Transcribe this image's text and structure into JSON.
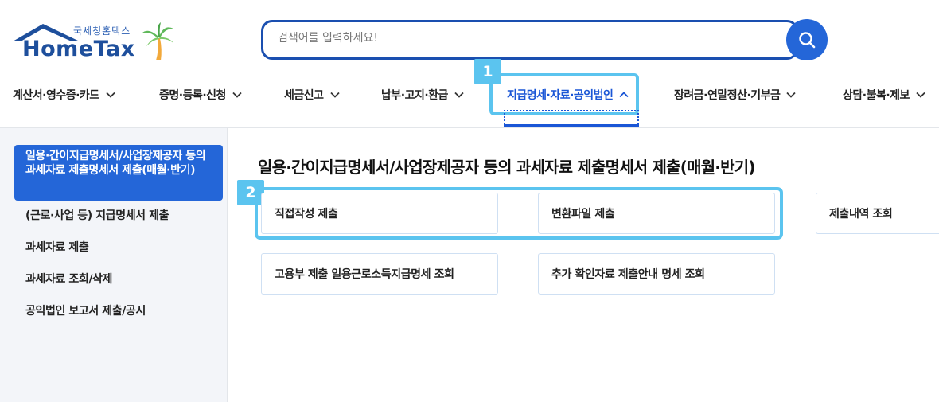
{
  "logo": {
    "sub": "국세청홈택스",
    "main": "HomeTax"
  },
  "search": {
    "placeholder": "검색어를 입력하세요!"
  },
  "nav": {
    "items": [
      {
        "label": "계산서·영수증·카드"
      },
      {
        "label": "증명·등록·신청"
      },
      {
        "label": "세금신고"
      },
      {
        "label": "납부·고지·환급"
      },
      {
        "label": "지급명세·자료·공익법인"
      },
      {
        "label": "장려금·연말정산·기부금"
      },
      {
        "label": "상담·불복·제보"
      }
    ]
  },
  "badges": {
    "one": "1",
    "two": "2"
  },
  "sidebar": {
    "items": [
      {
        "label": "일용·간이지급명세서/사업장제공자 등의 과세자료 제출명세서 제출(매월·반기)"
      },
      {
        "label": "(근로·사업 등) 지급명세서 제출"
      },
      {
        "label": "과세자료 제출"
      },
      {
        "label": "과세자료 조회/삭제"
      },
      {
        "label": "공익법인 보고서 제출/공시"
      }
    ]
  },
  "main": {
    "title": "일용·간이지급명세서/사업장제공자 등의 과세자료 제출명세서 제출(매월·반기)",
    "cards": [
      {
        "label": "직접작성 제출"
      },
      {
        "label": "변환파일 제출"
      },
      {
        "label": "제출내역 조회"
      },
      {
        "label": "고용부 제출 일용근로소득지급명세 조회"
      },
      {
        "label": "추가 확인자료 제출안내 명세 조회"
      }
    ]
  },
  "colors": {
    "primary": "#2466d8",
    "highlight": "#5bc4ef",
    "logo": "#1e4f9c"
  }
}
